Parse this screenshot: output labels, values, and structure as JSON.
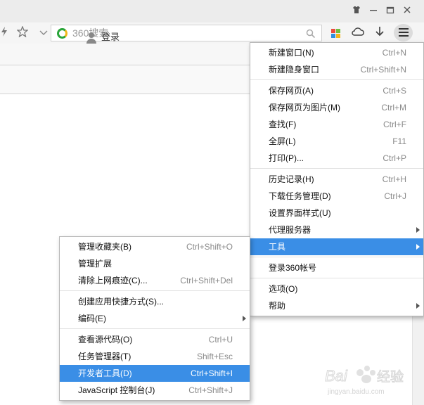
{
  "toolbar": {
    "search_placeholder": "360搜索"
  },
  "login": {
    "label": "登录"
  },
  "main_menu": {
    "groups": [
      [
        {
          "label": "新建窗口(N)",
          "shortcut": "Ctrl+N"
        },
        {
          "label": "新建隐身窗口",
          "shortcut": "Ctrl+Shift+N"
        }
      ],
      [
        {
          "label": "保存网页(A)",
          "shortcut": "Ctrl+S"
        },
        {
          "label": "保存网页为图片(M)",
          "shortcut": "Ctrl+M"
        },
        {
          "label": "查找(F)",
          "shortcut": "Ctrl+F"
        },
        {
          "label": "全屏(L)",
          "shortcut": "F11"
        },
        {
          "label": "打印(P)...",
          "shortcut": "Ctrl+P"
        }
      ],
      [
        {
          "label": "历史记录(H)",
          "shortcut": "Ctrl+H"
        },
        {
          "label": "下载任务管理(D)",
          "shortcut": "Ctrl+J"
        },
        {
          "label": "设置界面样式(U)",
          "shortcut": ""
        },
        {
          "label": "代理服务器",
          "shortcut": "",
          "submenu": true
        },
        {
          "label": "工具",
          "shortcut": "",
          "submenu": true,
          "highlighted": true
        }
      ],
      [
        {
          "label": "登录360帐号",
          "shortcut": ""
        }
      ],
      [
        {
          "label": "选项(O)",
          "shortcut": ""
        },
        {
          "label": "帮助",
          "shortcut": "",
          "submenu": true
        }
      ]
    ]
  },
  "tools_submenu": {
    "groups": [
      [
        {
          "label": "管理收藏夹(B)",
          "shortcut": "Ctrl+Shift+O"
        },
        {
          "label": "管理扩展",
          "shortcut": ""
        },
        {
          "label": "清除上网痕迹(C)...",
          "shortcut": "Ctrl+Shift+Del"
        }
      ],
      [
        {
          "label": "创建应用快捷方式(S)...",
          "shortcut": ""
        },
        {
          "label": "编码(E)",
          "shortcut": "",
          "submenu": true
        }
      ],
      [
        {
          "label": "查看源代码(O)",
          "shortcut": "Ctrl+U"
        },
        {
          "label": "任务管理器(T)",
          "shortcut": "Shift+Esc"
        },
        {
          "label": "开发者工具(D)",
          "shortcut": "Ctrl+Shift+I",
          "highlighted": true
        },
        {
          "label": "JavaScript 控制台(J)",
          "shortcut": "Ctrl+Shift+J"
        }
      ]
    ]
  },
  "watermark": {
    "brand": "Baidu经验",
    "url": "jingyan.baidu.com"
  },
  "colors": {
    "highlight": "#3a8ee6",
    "logo_green": "#2aa53a",
    "logo_yellow": "#f1b81a"
  }
}
